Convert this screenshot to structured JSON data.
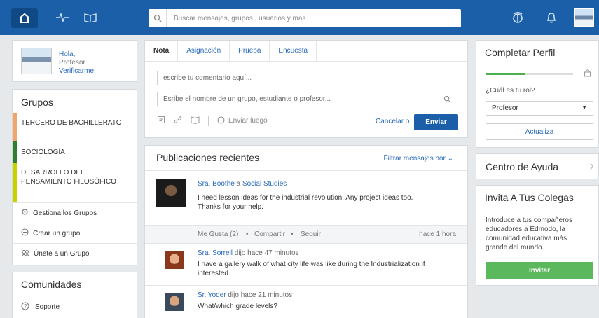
{
  "topbar": {
    "search_placeholder": "Buscar mensajes, grupos , usuarios y mas"
  },
  "user_card": {
    "greeting": "Hola,",
    "role": "Profesor",
    "verify": "Verificarme"
  },
  "groups": {
    "title": "Grupos",
    "items": [
      {
        "label": "TERCERO DE BACHILLERATO",
        "color": "#f2a46a"
      },
      {
        "label": "SOCIOLOGÍA",
        "color": "#2e7d32"
      },
      {
        "label": "DESARROLLO DEL PENSAMIENTO FILOSÓFICO",
        "color": "#c6d400"
      }
    ],
    "manage": "Gestiona los Grupos",
    "create": "Crear un grupo",
    "join": "Únete a un Grupo"
  },
  "communities": {
    "title": "Comunidades",
    "support": "Soporte"
  },
  "compose": {
    "tabs": [
      "Nota",
      "Asignación",
      "Prueba",
      "Encuesta"
    ],
    "comment_placeholder": "escribe tu comentario aquí...",
    "recipient_placeholder": "Esribe el nombre de un grupo, estudiante o profesor...",
    "schedule": "Enviar luego",
    "cancel": "Cancelar o",
    "send": "Enviar"
  },
  "posts": {
    "title": "Publicaciones recientes",
    "filter": "Filtrar mensajes por",
    "post": {
      "author": "Sra. Boothe",
      "connector": "a",
      "group": "Social Studies",
      "text": "I need lesson ideas for the industrial revolution. Any project ideas too. Thanks for your help.",
      "like": "Me Gusta (2)",
      "share": "Compartir",
      "follow": "Seguir",
      "time": "hace 1 hora"
    },
    "replies": [
      {
        "author": "Sra. Sorrell",
        "said": "dijo hace 47 minutos",
        "text": "I have a gallery walk of what city life was like during the Industrialization if interested."
      },
      {
        "author": "Sr. Yoder",
        "said": "dijo hace 21 minutos",
        "text": "What/which grade levels?"
      }
    ]
  },
  "profile": {
    "title": "Completar Perfil",
    "progress": 0.45,
    "question": "¿Cuál es tu rol?",
    "selected": "Profesor",
    "update": "Actualiza"
  },
  "help": {
    "title": "Centro de Ayuda"
  },
  "invite": {
    "title": "Invita A Tus Colegas",
    "text": "Introduce a tus compañeros educadores a Edmodo, la comunidad educativa más grande del mundo.",
    "button": "Invitar"
  }
}
